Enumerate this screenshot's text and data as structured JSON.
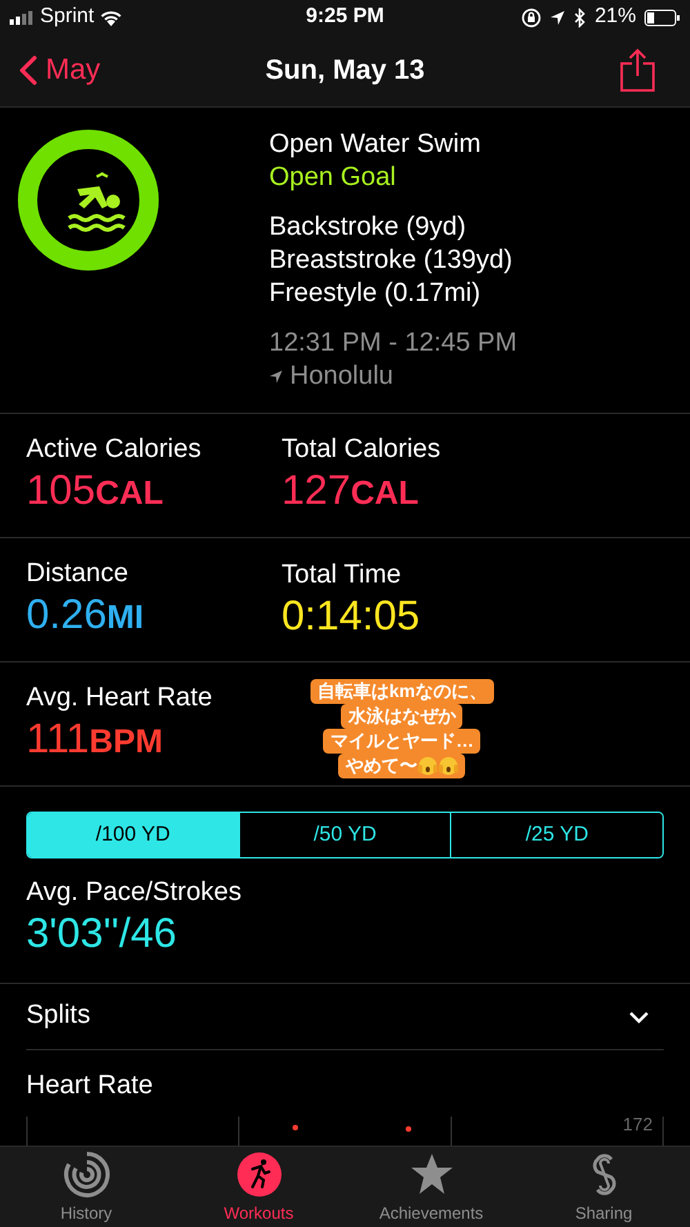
{
  "status_bar": {
    "carrier": "Sprint",
    "time": "9:25 PM",
    "battery": "21%"
  },
  "nav": {
    "back": "May",
    "title": "Sun, May 13"
  },
  "workout": {
    "name": "Open Water Swim",
    "goal": "Open Goal",
    "strokes": [
      "Backstroke (9yd)",
      "Breaststroke (139yd)",
      "Freestyle (0.17mi)"
    ],
    "time_range": "12:31 PM - 12:45 PM",
    "location": "Honolulu",
    "level": 1
  },
  "stats": [
    {
      "label": "Active Calories",
      "value": "105",
      "unit": "CAL",
      "color": "#ff2d55"
    },
    {
      "label": "Total Calories",
      "value": "127",
      "unit": "CAL",
      "color": "#ff2d55"
    },
    {
      "label": "Distance",
      "value": "0.26",
      "unit": "MI",
      "color": "#2fb0f0"
    },
    {
      "label": "Total Time",
      "value": "0:14:05",
      "color": "#ffe620"
    },
    {
      "label": "Avg. Heart Rate",
      "value": "111",
      "unit": "BPM",
      "color": "#ff3b30"
    }
  ],
  "sticker": {
    "lines": [
      "自転車はkmなのに、",
      "水泳はなぜか",
      "マイルとヤード…",
      "やめて〜"
    ]
  },
  "pace_segments": [
    {
      "label": "/100 YD",
      "selected": true
    },
    {
      "label": "/50 YD",
      "selected": false
    },
    {
      "label": "/25 YD",
      "selected": false
    }
  ],
  "pace": {
    "label": "Avg. Pace/Strokes",
    "value": "3'03''/46"
  },
  "splits": {
    "label": "Splits",
    "expanded": false
  },
  "heart_rate": {
    "label": "Heart Rate",
    "max_label": "172"
  },
  "tab_bar": [
    {
      "label": "History",
      "kind": "history",
      "selected": false
    },
    {
      "label": "Workouts",
      "kind": "workouts",
      "selected": true
    },
    {
      "label": "Achievements",
      "kind": "achievements",
      "selected": false
    },
    {
      "label": "Sharing",
      "kind": "sharing",
      "selected": false
    }
  ]
}
